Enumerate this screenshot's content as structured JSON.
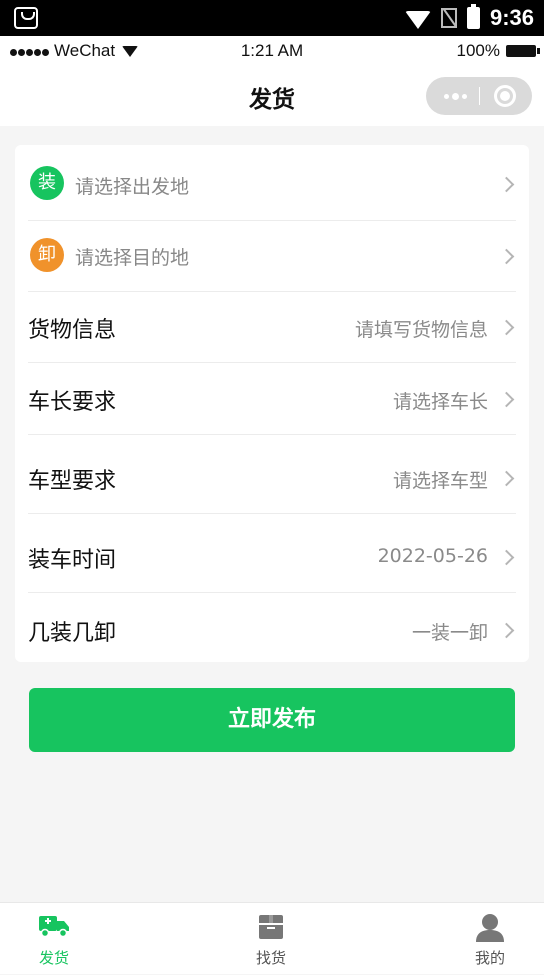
{
  "android_status": {
    "time": "9:36"
  },
  "ios_status": {
    "carrier": "WeChat",
    "time": "1:21 AM",
    "battery": "100%"
  },
  "nav": {
    "title": "发货"
  },
  "route": {
    "origin": {
      "tag": "装",
      "placeholder": "请选择出发地",
      "color": "#17c45f"
    },
    "destination": {
      "tag": "卸",
      "placeholder": "请选择目的地",
      "color": "#f0922b"
    }
  },
  "fields": [
    {
      "label": "货物信息",
      "value": "请填写货物信息"
    },
    {
      "label": "车长要求",
      "value": "请选择车长"
    },
    {
      "label": "车型要求",
      "value": "请选择车型"
    },
    {
      "label": "装车时间",
      "value": "2022-05-26"
    },
    {
      "label": "几装几卸",
      "value": "一装一卸"
    }
  ],
  "submit": {
    "label": "立即发布"
  },
  "tabs": [
    {
      "label": "发货",
      "icon": "truck-icon",
      "active": true
    },
    {
      "label": "找货",
      "icon": "cargo-box-icon",
      "active": false
    },
    {
      "label": "我的",
      "icon": "user-icon",
      "active": false
    }
  ],
  "colors": {
    "accent": "#17c45f",
    "unload": "#f0922b"
  }
}
